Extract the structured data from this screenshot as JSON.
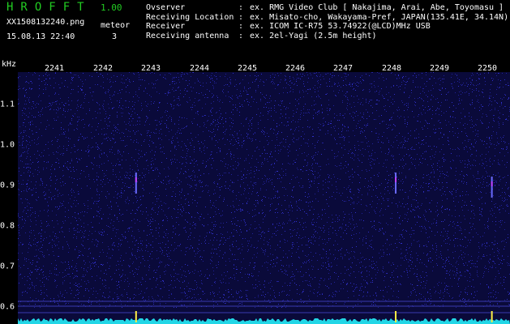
{
  "app": {
    "title": "HROFFT",
    "version": "1.00"
  },
  "file": {
    "name": "XX1508132240.png",
    "datetime": "15.08.13 22:40"
  },
  "meteor": {
    "label": "meteor",
    "count": "3"
  },
  "info": [
    {
      "key": "Ovserver",
      "colon": ":",
      "value": "ex. RMG Video Club [ Nakajima, Arai, Abe, Toyomasu ]"
    },
    {
      "key": "Receiving Location",
      "colon": ":",
      "value": "ex. Misato-cho, Wakayama-Pref, JAPAN(135.41E, 34.14N)"
    },
    {
      "key": "Receiver",
      "colon": ":",
      "value": "ex. ICOM IC-R75 53.74922(@LCD)MHz USB"
    },
    {
      "key": "Receiving antenna",
      "colon": ":",
      "value": "ex. 2el-Yagi (2.5m height)"
    }
  ],
  "axis": {
    "y_unit": "kHz",
    "x_ticks": [
      "2241",
      "2242",
      "2243",
      "2244",
      "2245",
      "2246",
      "2247",
      "2248",
      "2249",
      "2250"
    ],
    "y_ticks": [
      "1.1",
      "1.0",
      "0.9",
      "0.8",
      "0.7",
      "0.6"
    ]
  },
  "colors": {
    "background": "#000000",
    "title": "#22cc22",
    "text": "#ffffff",
    "noise": "#0a0a3a",
    "baseline": "#22d6e6",
    "echo": "#ffee44"
  },
  "echoes": [
    {
      "minute": "2242.7",
      "freq_khz": "0.92"
    },
    {
      "minute": "2248.1",
      "freq_khz": "0.92"
    },
    {
      "minute": "2250.1",
      "freq_khz": "0.91"
    }
  ]
}
